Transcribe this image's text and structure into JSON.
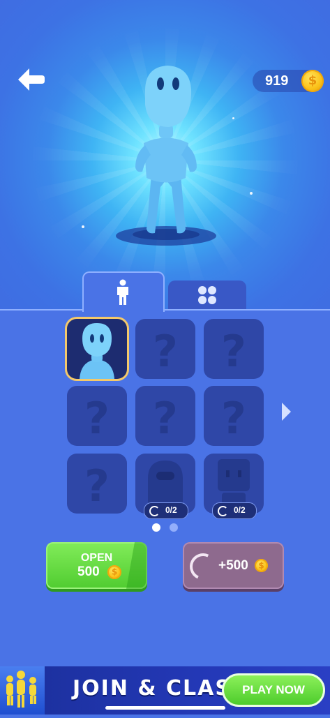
{
  "header": {
    "back_icon": "arrow-left-icon",
    "coins": "919",
    "coin_icon": "coin-icon"
  },
  "tabs": [
    {
      "icon": "person-icon",
      "selected": true
    },
    {
      "icon": "grid-icon",
      "selected": false
    }
  ],
  "grid": {
    "cells": [
      {
        "state": "selected",
        "content": "character"
      },
      {
        "state": "locked",
        "content": "?"
      },
      {
        "state": "locked",
        "content": "?"
      },
      {
        "state": "locked",
        "content": "?"
      },
      {
        "state": "locked",
        "content": "?"
      },
      {
        "state": "locked",
        "content": "?"
      },
      {
        "state": "locked",
        "content": "?"
      },
      {
        "state": "progress",
        "content": "hooded-figure",
        "progress": "0/2"
      },
      {
        "state": "progress",
        "content": "robot-figure",
        "progress": "0/2"
      }
    ],
    "page_indicator": {
      "pages": 2,
      "current": 1
    }
  },
  "actions": {
    "open": {
      "label": "OPEN",
      "price": "500"
    },
    "ad_reward": {
      "label": "+500"
    }
  },
  "banner": {
    "title": "JOIN & CLASH",
    "button": "PLAY NOW"
  },
  "colors": {
    "background": "#4a73e6",
    "accent_green": "#50cc30",
    "coin": "#fbc21a",
    "selected_border": "#f4c96a"
  }
}
